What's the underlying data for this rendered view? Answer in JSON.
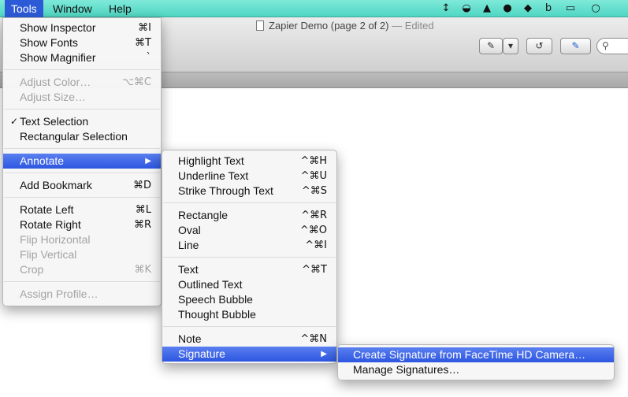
{
  "menubar": {
    "items": [
      {
        "label": "Tools",
        "active": true
      },
      {
        "label": "Window",
        "active": false
      },
      {
        "label": "Help",
        "active": false
      }
    ],
    "status_icons": [
      "sync-arrows-icon",
      "cloud-drive-icon",
      "google-drive-icon",
      "evernote-icon",
      "dropbox-icon",
      "b-app-icon",
      "airplay-icon",
      "messages-icon"
    ],
    "status_glyphs": [
      "↕",
      "◒",
      "▲",
      "●",
      "◆",
      "b",
      "▭",
      "○"
    ]
  },
  "window": {
    "title": "Zapier Demo (page 2 of 2)",
    "edited": "— Edited"
  },
  "toolbar": {
    "annotate_glyph": "✎",
    "dropdown_glyph": "▾",
    "rotate_glyph": "↺",
    "edit_glyph": "✎",
    "search_glyph": "⚲"
  },
  "tools_menu": {
    "groups": [
      [
        {
          "label": "Show Inspector",
          "shortcut": "⌘I",
          "disabled": false
        },
        {
          "label": "Show Fonts",
          "shortcut": "⌘T",
          "disabled": false
        },
        {
          "label": "Show Magnifier",
          "shortcut": "`",
          "disabled": false
        }
      ],
      [
        {
          "label": "Adjust Color…",
          "shortcut": "⌥⌘C",
          "disabled": true
        },
        {
          "label": "Adjust Size…",
          "shortcut": "",
          "disabled": true
        }
      ],
      [
        {
          "label": "Text Selection",
          "shortcut": "",
          "disabled": false,
          "checked": true
        },
        {
          "label": "Rectangular Selection",
          "shortcut": "",
          "disabled": false
        }
      ],
      [
        {
          "label": "Annotate",
          "shortcut": "",
          "disabled": false,
          "submenu": true,
          "highlighted": true
        }
      ],
      [
        {
          "label": "Add Bookmark",
          "shortcut": "⌘D",
          "disabled": false
        }
      ],
      [
        {
          "label": "Rotate Left",
          "shortcut": "⌘L",
          "disabled": false
        },
        {
          "label": "Rotate Right",
          "shortcut": "⌘R",
          "disabled": false
        },
        {
          "label": "Flip Horizontal",
          "shortcut": "",
          "disabled": true
        },
        {
          "label": "Flip Vertical",
          "shortcut": "",
          "disabled": true
        },
        {
          "label": "Crop",
          "shortcut": "⌘K",
          "disabled": true
        }
      ],
      [
        {
          "label": "Assign Profile…",
          "shortcut": "",
          "disabled": true
        }
      ]
    ],
    "check_glyph": "✓",
    "arrow_glyph": "▶"
  },
  "annotate_menu": {
    "groups": [
      [
        {
          "label": "Highlight Text",
          "shortcut": "^⌘H"
        },
        {
          "label": "Underline Text",
          "shortcut": "^⌘U"
        },
        {
          "label": "Strike Through Text",
          "shortcut": "^⌘S"
        }
      ],
      [
        {
          "label": "Rectangle",
          "shortcut": "^⌘R"
        },
        {
          "label": "Oval",
          "shortcut": "^⌘O"
        },
        {
          "label": "Line",
          "shortcut": "^⌘I"
        }
      ],
      [
        {
          "label": "Text",
          "shortcut": "^⌘T"
        },
        {
          "label": "Outlined Text",
          "shortcut": ""
        },
        {
          "label": "Speech Bubble",
          "shortcut": ""
        },
        {
          "label": "Thought Bubble",
          "shortcut": ""
        }
      ],
      [
        {
          "label": "Note",
          "shortcut": "^⌘N"
        },
        {
          "label": "Signature",
          "shortcut": "",
          "submenu": true,
          "highlighted": true
        }
      ]
    ]
  },
  "signature_menu": {
    "items": [
      {
        "label": "Create Signature from FaceTime HD Camera…",
        "highlighted": true
      },
      {
        "label": "Manage Signatures…",
        "highlighted": false
      }
    ]
  }
}
